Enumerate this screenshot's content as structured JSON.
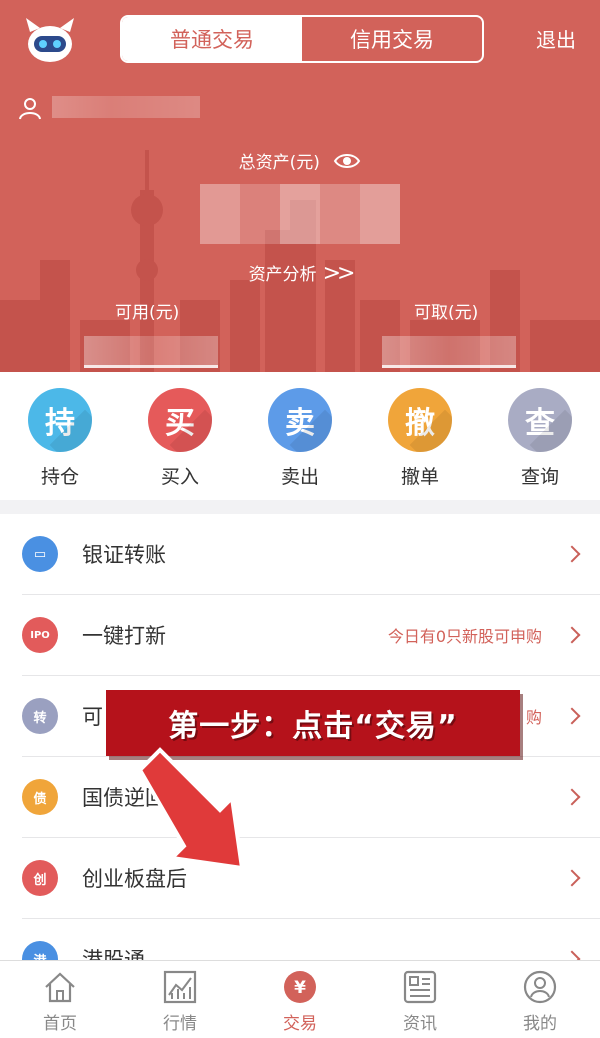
{
  "header": {
    "tabs": [
      {
        "label": "普通交易",
        "active": true
      },
      {
        "label": "信用交易",
        "active": false
      }
    ],
    "logout_label": "退出",
    "total_assets_label": "总资产(元)",
    "asset_analysis_label": "资产分析",
    "available_label": "可用(元)",
    "withdrawable_label": "可取(元)"
  },
  "quick_actions": [
    {
      "glyph": "持",
      "label": "持仓",
      "color": "#4cb8e8"
    },
    {
      "glyph": "买",
      "label": "买入",
      "color": "#e55a5a"
    },
    {
      "glyph": "卖",
      "label": "卖出",
      "color": "#5d9be8"
    },
    {
      "glyph": "撤",
      "label": "撤单",
      "color": "#f0a53a"
    },
    {
      "glyph": "查",
      "label": "查询",
      "color": "#a9acc4"
    }
  ],
  "menu": [
    {
      "label": "银证转账",
      "extra": "",
      "icon": "bank-card-icon",
      "icon_glyph": "▭",
      "color": "#4a90e2"
    },
    {
      "label": "一键打新",
      "extra": "今日有0只新股可申购",
      "icon": "ipo-icon",
      "icon_glyph": "IPO",
      "color": "#e25b5b"
    },
    {
      "label": "可",
      "extra": "购",
      "icon": "convert-icon",
      "icon_glyph": "转",
      "color": "#9aa0c0"
    },
    {
      "label": "国债逆回购",
      "extra": "",
      "icon": "bond-icon",
      "icon_glyph": "债",
      "color": "#f0a53a"
    },
    {
      "label": "创业板盘后",
      "extra": "",
      "icon": "chinext-icon",
      "icon_glyph": "创",
      "color": "#e25b5b"
    },
    {
      "label": "港股通",
      "extra": "",
      "icon": "hk-connect-icon",
      "icon_glyph": "港",
      "color": "#4a90e2"
    }
  ],
  "overlay": {
    "instruction": "第一步：点击“交易”"
  },
  "bottom_nav": [
    {
      "label": "首页",
      "icon": "home-icon",
      "active": false
    },
    {
      "label": "行情",
      "icon": "chart-icon",
      "active": false
    },
    {
      "label": "交易",
      "icon": "yuan-icon",
      "active": true
    },
    {
      "label": "资讯",
      "icon": "news-icon",
      "active": false
    },
    {
      "label": "我的",
      "icon": "profile-icon",
      "active": false
    }
  ],
  "colors": {
    "brand_red": "#d2625a",
    "banner_red": "#b5121b"
  }
}
